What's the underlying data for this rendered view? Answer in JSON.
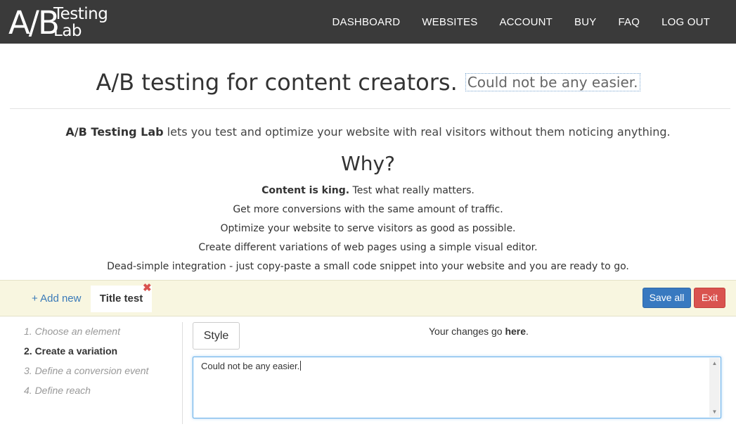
{
  "header": {
    "logo_ab": "A/B",
    "logo_top": "Testing",
    "logo_bottom": "Lab",
    "nav": [
      "DASHBOARD",
      "WEBSITES",
      "ACCOUNT",
      "BUY",
      "FAQ",
      "LOG OUT"
    ]
  },
  "hero": {
    "title": "A/B testing for content creators.",
    "subtitle": "Could not be any easier.",
    "intro_brand": "A/B Testing Lab",
    "intro_rest": " lets you test and optimize your website with real visitors without them noticing anything.",
    "why": "Why?",
    "features": [
      {
        "bold": "Content is king.",
        "text": " Test what really matters."
      },
      {
        "bold": "",
        "text": "Get more conversions with the same amount of traffic."
      },
      {
        "bold": "",
        "text": "Optimize your website to serve visitors as good as possible."
      },
      {
        "bold": "",
        "text": "Create different variations of web pages using a simple visual editor."
      },
      {
        "bold": "",
        "text": "Dead-simple integration - just copy-paste a small code snippet into your website and you are ready to go."
      }
    ]
  },
  "toolbar": {
    "add_new": "+ Add new",
    "tab_label": "Title test",
    "tab_close": "✖",
    "save_all": "Save all",
    "exit": "Exit"
  },
  "steps": [
    {
      "label": "1. Choose an element",
      "active": false
    },
    {
      "label": "2. Create a variation",
      "active": true
    },
    {
      "label": "3. Define a conversion event",
      "active": false
    },
    {
      "label": "4. Define reach",
      "active": false
    }
  ],
  "panel": {
    "style_button": "Style",
    "changes_prefix": "Your changes go ",
    "changes_bold": "here",
    "changes_suffix": ".",
    "editor_value": "Could not be any easier."
  },
  "colors": {
    "topbar": "#3a3a3a",
    "toolbar_bg": "#f8f6e0",
    "primary": "#3879c0",
    "danger": "#d9534f",
    "link": "#3a7ab8"
  }
}
